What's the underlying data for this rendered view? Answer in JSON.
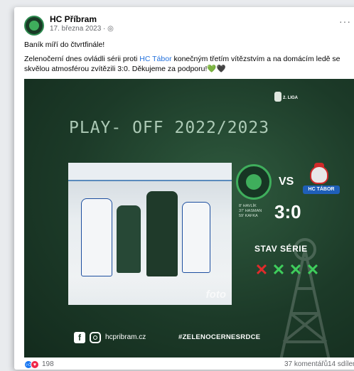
{
  "post": {
    "page_name": "HC Příbram",
    "date": "17. března 2023 ·",
    "audience_icon": "globe-icon",
    "more_label": "···",
    "line1": "Baník míří do čtvrtfinále!",
    "line2_before": "Zelenočerní dnes ovládli sérii proti ",
    "line2_link": "HC Tábor",
    "line2_after": " konečným třetím vítězstvím a na domácím ledě se skvělou atmosférou zvítězili 3:0. Děkujeme za podporu!💚🖤"
  },
  "graphic": {
    "league": "2. LIGA",
    "headline": "PLAY- OFF  2022/2023",
    "vs": "VS",
    "away_banner": "HC TÁBOR",
    "scorers": [
      "8' HAVLÍK",
      "37' HASMAN",
      "59' KAFKA"
    ],
    "score": "3:0",
    "series_label": "STAV SÉRIE",
    "series_marks": [
      {
        "symbol": "✕",
        "result": "loss"
      },
      {
        "symbol": "✕",
        "result": "win"
      },
      {
        "symbol": "✕",
        "result": "win"
      },
      {
        "symbol": "✕",
        "result": "win"
      }
    ],
    "photo_credit": "foto",
    "fb_glyph": "f",
    "website": "hcpribram.cz",
    "hashtag": "#ZELENOCERNESRDCE",
    "colors": {
      "green": "#3fce5c",
      "red": "#e02b2b",
      "dark": "#1c3a28"
    }
  },
  "footer": {
    "reaction_count": "198",
    "comments": "37 komentářů",
    "shares": "14 sdílení"
  }
}
